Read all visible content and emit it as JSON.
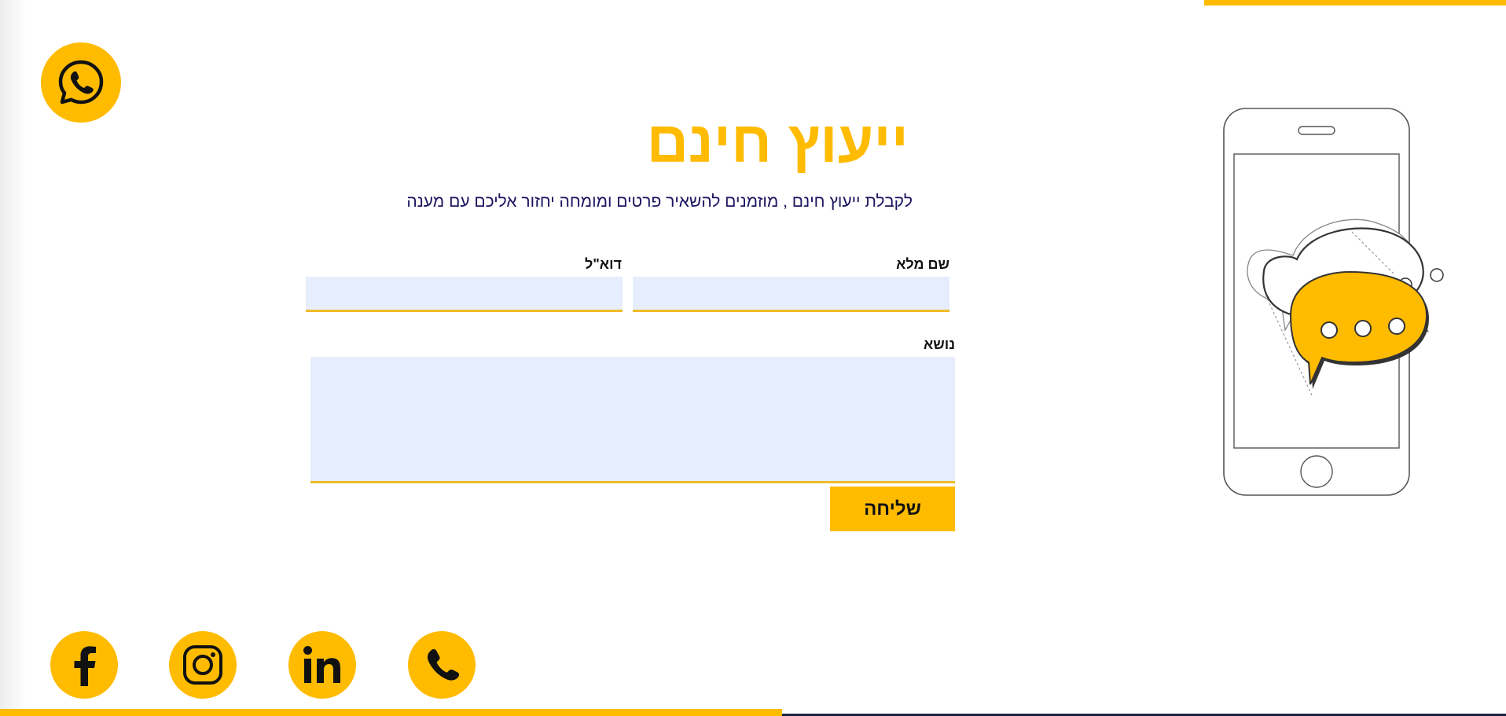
{
  "header": {
    "title": "ייעוץ חינם",
    "subtitle": "לקבלת ייעוץ חינם , מוזמנים להשאיר פרטים ומומחה יחזור אליכם עם מענה"
  },
  "form": {
    "full_name_label": "שם מלא",
    "email_label": "דוא\"ל",
    "subject_label": "נושא",
    "submit_label": "שליחה",
    "full_name_value": "",
    "email_value": "",
    "subject_value": ""
  },
  "floating": {
    "whatsapp_icon": "whatsapp-icon"
  },
  "social": [
    {
      "icon": "phone-icon"
    },
    {
      "icon": "linkedin-icon"
    },
    {
      "icon": "instagram-icon"
    },
    {
      "icon": "facebook-icon"
    }
  ],
  "colors": {
    "accent": "#FFBB00",
    "field_background": "#E6EEFE",
    "subtitle_text": "#1b1460",
    "footer_line": "#1c2541"
  }
}
